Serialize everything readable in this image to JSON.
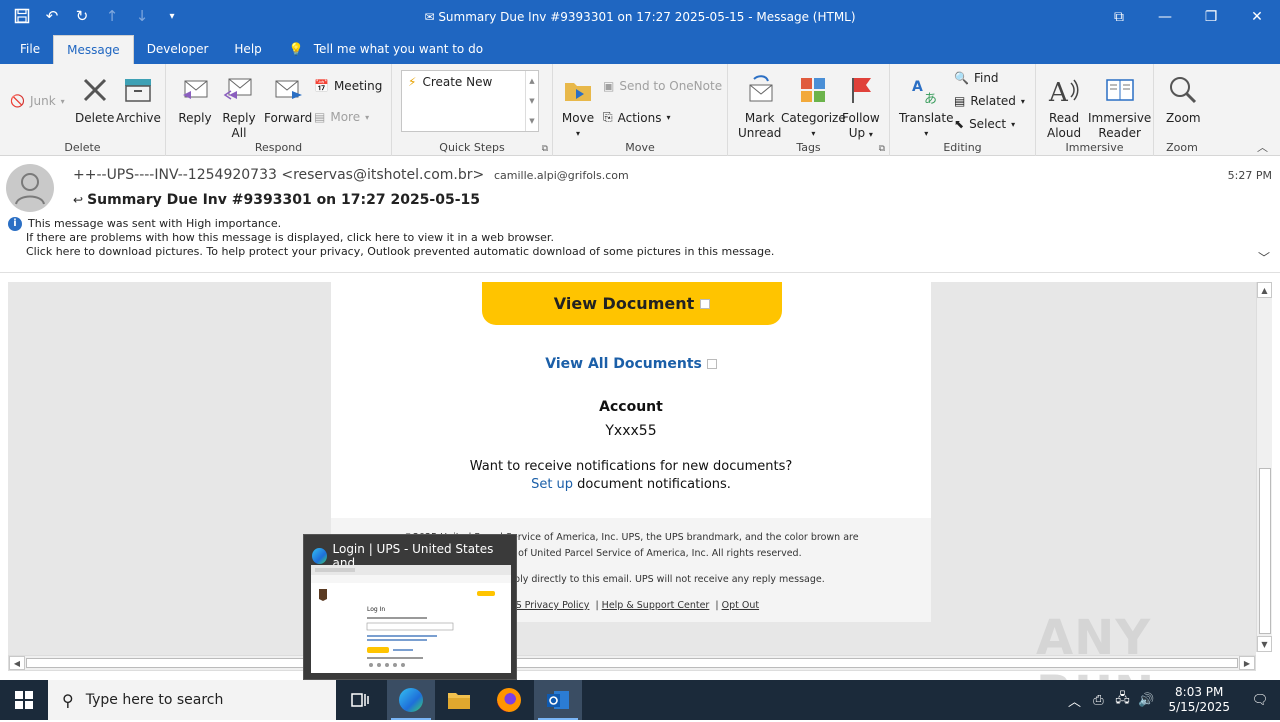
{
  "titlebar": {
    "title": "Summary Due Inv #9393301 on 17:27 2025-05-15  -  Message (HTML)"
  },
  "tabs": [
    "File",
    "Message",
    "Developer",
    "Help"
  ],
  "tell_me": "Tell me what you want to do",
  "ribbon": {
    "delete_group": {
      "junk": "Junk",
      "delete": "Delete",
      "archive": "Archive",
      "label": "Delete"
    },
    "respond_group": {
      "reply": "Reply",
      "reply_all_1": "Reply",
      "reply_all_2": "All",
      "forward": "Forward",
      "meeting": "Meeting",
      "more": "More",
      "label": "Respond"
    },
    "quick_steps": {
      "create_new": "Create New",
      "label": "Quick Steps"
    },
    "move_group": {
      "move": "Move",
      "onenote": "Send to OneNote",
      "actions": "Actions",
      "label": "Move"
    },
    "tags_group": {
      "mark_unread_1": "Mark",
      "mark_unread_2": "Unread",
      "categorize": "Categorize",
      "follow_up_1": "Follow",
      "follow_up_2": "Up",
      "label": "Tags"
    },
    "editing_group": {
      "translate": "Translate",
      "find": "Find",
      "related": "Related",
      "select": "Select",
      "label": "Editing"
    },
    "immersive_group": {
      "read_aloud_1": "Read",
      "read_aloud_2": "Aloud",
      "immersive_reader_1": "Immersive",
      "immersive_reader_2": "Reader",
      "label": "Immersive"
    },
    "zoom_group": {
      "zoom": "Zoom",
      "label": "Zoom"
    }
  },
  "message": {
    "sender": "++--UPS----INV--1254920733 <reservas@itshotel.com.br>",
    "to": "camille.alpi@grifols.com",
    "time": "5:27 PM",
    "subject": "Summary Due Inv #9393301 on 17:27 2025-05-15",
    "info_importance": "This message was sent with High importance.",
    "info_display": "If there are problems with how this message is displayed, click here to view it in a web browser.",
    "info_pictures": "Click here to download pictures. To help protect your privacy, Outlook prevented automatic download of some pictures in this message."
  },
  "email_body": {
    "view_document": "View Document",
    "view_all": "View All Documents",
    "account_label": "Account",
    "account_value": "Yxxx55",
    "notif_text": "Want to receive notifications for new documents?",
    "setup_link": "Set up",
    "setup_rest": " document notifications.",
    "footer_line1": "©2025 United Parcel Service of America, Inc. UPS, the UPS brandmark, and the color brown are",
    "footer_line2": "trademarks of United Parcel Service of America, Inc. All rights reserved.",
    "footer_line3": "Please do not reply directly to this email. UPS will not receive any reply message.",
    "footer_privacy": "UPS Privacy Policy",
    "footer_help": "Help & Support Center",
    "footer_optout": "Opt Out"
  },
  "taskbar_preview": {
    "title": "Login | UPS - United States and ..."
  },
  "taskbar": {
    "search_placeholder": "Type here to search",
    "time": "8:03 PM",
    "date": "5/15/2025"
  },
  "watermark": "ANY RUN",
  "colors": {
    "outlook_blue": "#1f66c1",
    "ups_yellow": "#ffc400",
    "link_blue": "#1b5fa8"
  }
}
